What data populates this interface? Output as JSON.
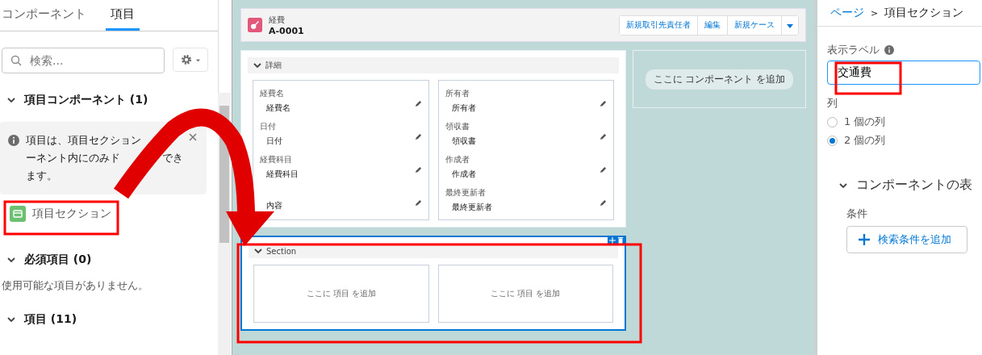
{
  "left_panel": {
    "tabs": [
      {
        "label": "コンポーネント",
        "selected": false
      },
      {
        "label": "項目",
        "selected": true
      }
    ],
    "search": {
      "placeholder": "検索..."
    },
    "groups": [
      {
        "title": "項目コンポーネント (1)",
        "expanded": true,
        "info_lines": [
          [
            "項目は、項目セクション"
          ],
          [
            "ーネント内にのみド",
            "でき"
          ],
          [
            "ます。"
          ]
        ],
        "items": [
          "項目セクション"
        ]
      },
      {
        "title": "必須項目 (0)",
        "expanded": true,
        "empty_text": "使用可能な項目がありません。"
      },
      {
        "title": "項目 (11)",
        "expanded": true
      }
    ]
  },
  "canvas": {
    "header": {
      "object": "経費",
      "record": "A-0001",
      "actions": [
        "新規取引先責任者",
        "編集",
        "新規ケース"
      ]
    },
    "sections": [
      {
        "title": "詳細",
        "selected": false,
        "columns": [
          [
            {
              "label": "経費名",
              "value": "経費名"
            },
            {
              "label": "日付",
              "value": "日付"
            },
            {
              "label": "経費科目",
              "value": "経費科目"
            },
            {
              "value": "内容"
            }
          ],
          [
            {
              "label": "所有者",
              "value": "所有者"
            },
            {
              "label": "領収書",
              "value": "領収書"
            },
            {
              "label": "作成者",
              "value": "作成者"
            },
            {
              "label": "最終更新者",
              "value": "最終更新者"
            }
          ]
        ]
      },
      {
        "title": "Section",
        "selected": true,
        "drop_hints": [
          "ここに 項目 を追加",
          "ここに 項目 を追加"
        ]
      }
    ],
    "side_drop_hint": "ここに コンポーネント を追加"
  },
  "right_panel": {
    "breadcrumb": [
      "ページ",
      "項目セクション"
    ],
    "separator": ">",
    "label_field": {
      "label": "表示ラベル",
      "value": "交通費"
    },
    "columns_label": "列",
    "column_options": [
      {
        "label": "1 個の列",
        "selected": false
      },
      {
        "label": "2 個の列",
        "selected": true
      }
    ],
    "visibility_title": "コンポーネントの表",
    "conditions_label": "条件",
    "add_filter": "検索条件を追加"
  }
}
